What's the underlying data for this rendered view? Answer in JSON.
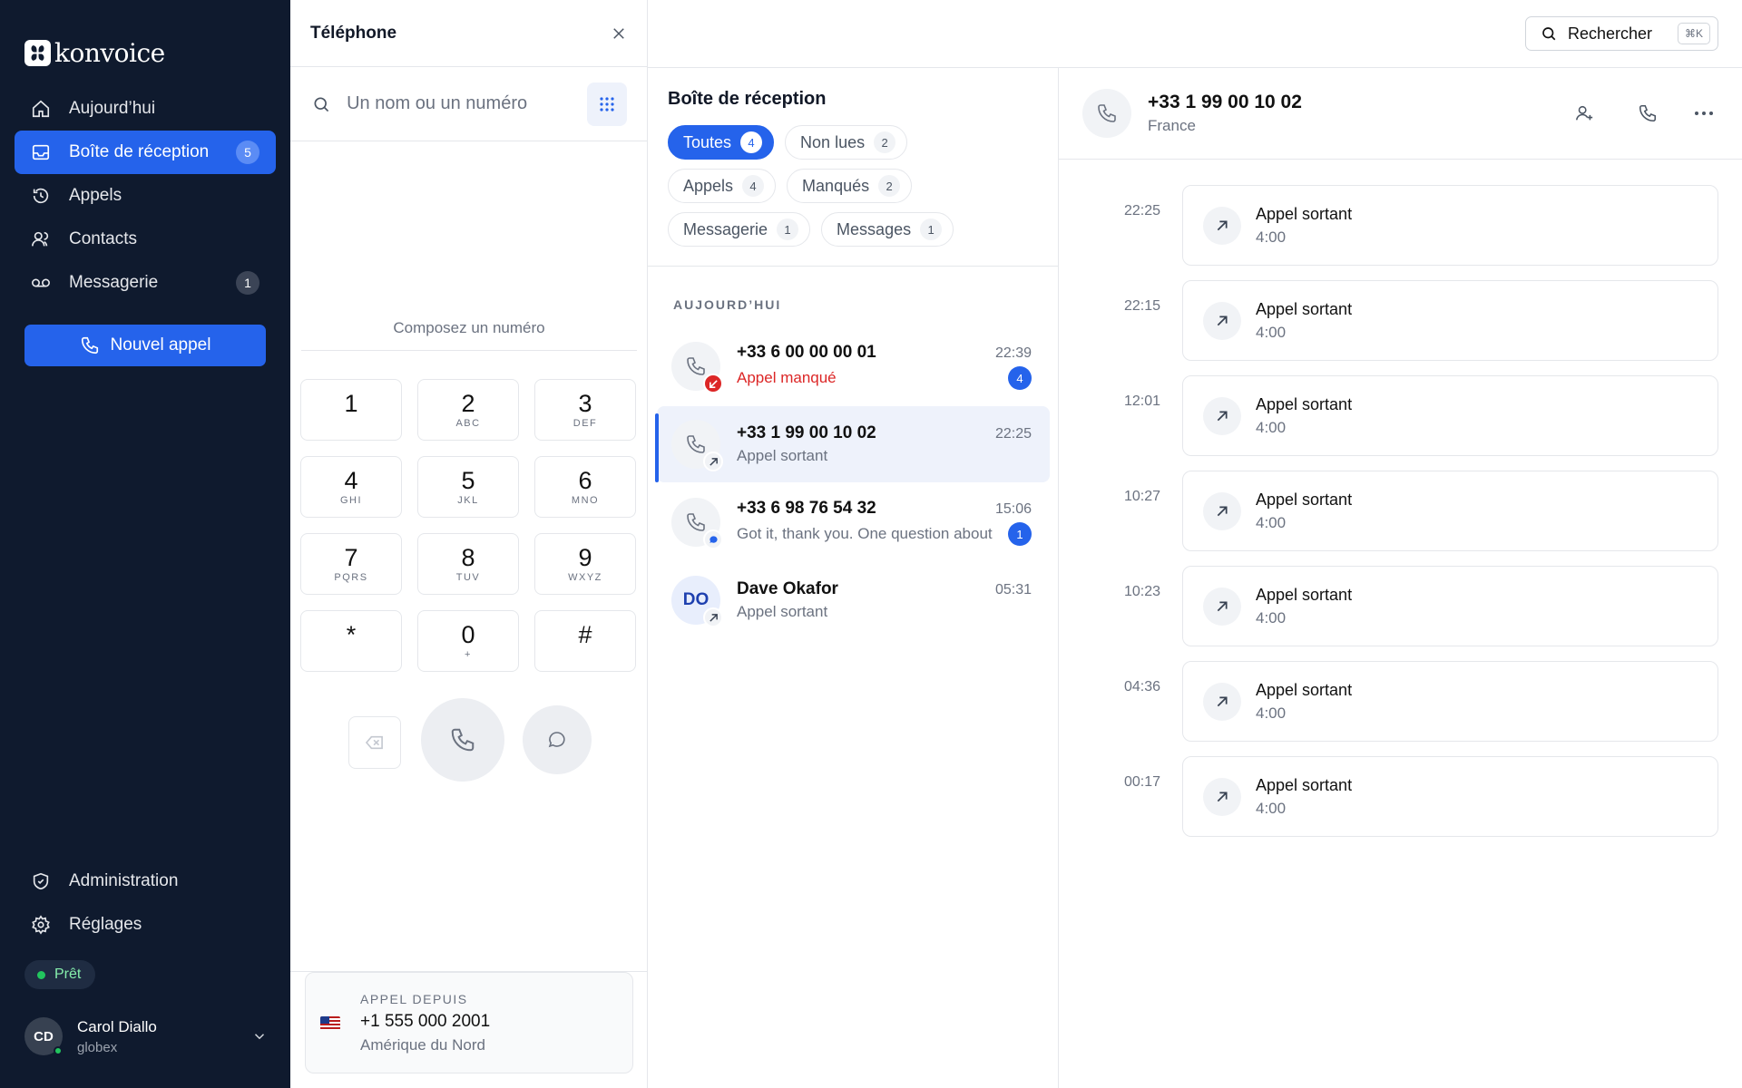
{
  "app": {
    "name": "konvoice"
  },
  "sidebar": {
    "items": [
      {
        "label": "Aujourd’hui",
        "icon": "home-icon"
      },
      {
        "label": "Boîte de réception",
        "icon": "inbox-icon",
        "badge": "5",
        "active": true
      },
      {
        "label": "Appels",
        "icon": "history-icon"
      },
      {
        "label": "Contacts",
        "icon": "users-icon"
      },
      {
        "label": "Messagerie",
        "icon": "voicemail-icon",
        "badge": "1"
      }
    ],
    "new_call_label": "Nouvel appel",
    "bottom_items": [
      {
        "label": "Administration",
        "icon": "shield-icon"
      },
      {
        "label": "Réglages",
        "icon": "gear-icon"
      }
    ],
    "status": "Prêt",
    "user": {
      "initials": "CD",
      "name": "Carol Diallo",
      "org": "globex"
    }
  },
  "phone": {
    "title": "Téléphone",
    "search_placeholder": "Un nom ou un numéro",
    "dial_prompt": "Composez un numéro",
    "keys": [
      {
        "d": "1",
        "s": ""
      },
      {
        "d": "2",
        "s": "ABC"
      },
      {
        "d": "3",
        "s": "DEF"
      },
      {
        "d": "4",
        "s": "GHI"
      },
      {
        "d": "5",
        "s": "JKL"
      },
      {
        "d": "6",
        "s": "MNO"
      },
      {
        "d": "7",
        "s": "PQRS"
      },
      {
        "d": "8",
        "s": "TUV"
      },
      {
        "d": "9",
        "s": "WXYZ"
      },
      {
        "d": "*",
        "s": ""
      },
      {
        "d": "0",
        "s": "+"
      },
      {
        "d": "#",
        "s": ""
      }
    ],
    "call_from": {
      "label": "APPEL DEPUIS",
      "number": "+1 555 000 2001",
      "region": "Amérique du Nord"
    }
  },
  "search": {
    "label": "Rechercher",
    "shortcut": "⌘K"
  },
  "inbox": {
    "title": "Boîte de réception",
    "filters": [
      [
        {
          "label": "Toutes",
          "count": "4",
          "active": true
        },
        {
          "label": "Non lues",
          "count": "2"
        }
      ],
      [
        {
          "label": "Appels",
          "count": "4"
        },
        {
          "label": "Manqués",
          "count": "2"
        }
      ],
      [
        {
          "label": "Messagerie",
          "count": "1"
        },
        {
          "label": "Messages",
          "count": "1"
        }
      ]
    ],
    "section": "AUJOURD’HUI",
    "items": [
      {
        "name": "+33 6 00 00 00 01",
        "sub": "Appel manqué",
        "time": "22:39",
        "unread": "4",
        "kind": "missed"
      },
      {
        "name": "+33 1 99 00 10 02",
        "sub": "Appel sortant",
        "time": "22:25",
        "unread": "",
        "kind": "outgoing",
        "selected": true
      },
      {
        "name": "+33 6 98 76 54 32",
        "sub": "Got it, thank you. One question about",
        "time": "15:06",
        "unread": "1",
        "kind": "message"
      },
      {
        "name": "Dave Okafor",
        "sub": "Appel sortant",
        "time": "05:31",
        "unread": "",
        "kind": "outgoing",
        "initials": "DO"
      }
    ]
  },
  "detail": {
    "number": "+33 1 99 00 10 02",
    "country": "France",
    "events": [
      {
        "time": "22:25",
        "title": "Appel sortant",
        "duration": "4:00"
      },
      {
        "time": "22:15",
        "title": "Appel sortant",
        "duration": "4:00"
      },
      {
        "time": "12:01",
        "title": "Appel sortant",
        "duration": "4:00"
      },
      {
        "time": "10:27",
        "title": "Appel sortant",
        "duration": "4:00"
      },
      {
        "time": "10:23",
        "title": "Appel sortant",
        "duration": "4:00"
      },
      {
        "time": "04:36",
        "title": "Appel sortant",
        "duration": "4:00"
      },
      {
        "time": "00:17",
        "title": "Appel sortant",
        "duration": "4:00"
      }
    ]
  },
  "colors": {
    "sidebar_bg": "#0f1a2e",
    "accent": "#2563eb",
    "missed": "#dc2626",
    "ready": "#22c55e"
  }
}
